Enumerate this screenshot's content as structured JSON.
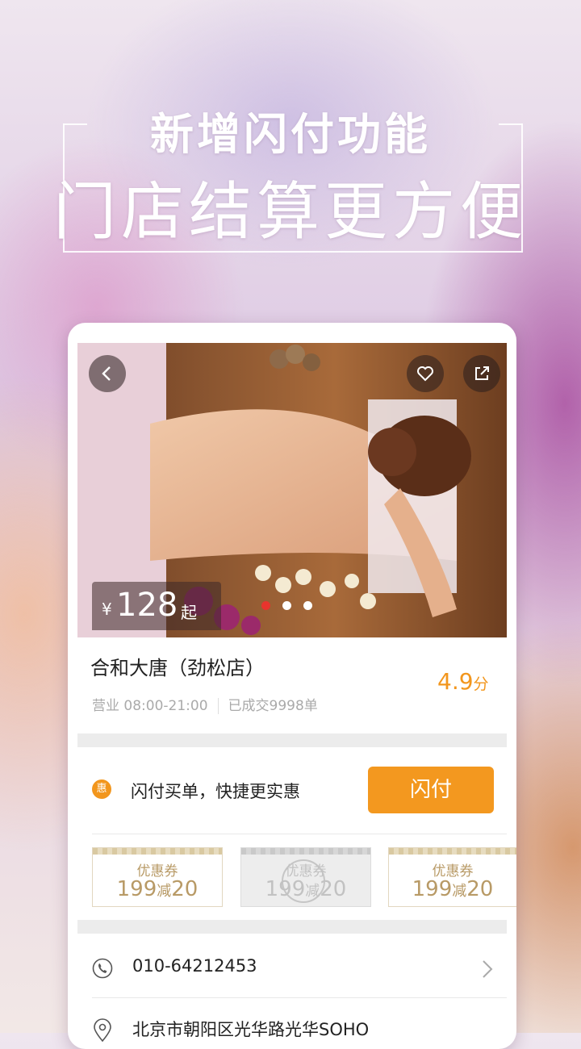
{
  "headline": {
    "line1": "新增闪付功能",
    "line2": "门店结算更方便"
  },
  "shop": {
    "price_currency": "¥",
    "price_value": "128",
    "price_suffix": "起",
    "name": "合和大唐（劲松店）",
    "rating_value": "4.9",
    "rating_unit": "分",
    "hours": "营业 08:00-21:00",
    "sold": "已成交9998单",
    "carousel": {
      "count": 3,
      "active": 0
    }
  },
  "promo": {
    "badge": "惠",
    "text": "闪付买单，快捷更实惠",
    "button": "闪付"
  },
  "coupons": [
    {
      "title": "优惠券",
      "amount_a": "199",
      "amount_mid": "减",
      "amount_b": "20",
      "state": "available"
    },
    {
      "title": "优惠券",
      "amount_a": "199",
      "amount_mid": "减",
      "amount_b": "20",
      "state": "used"
    },
    {
      "title": "优惠券",
      "amount_a": "199",
      "amount_mid": "减",
      "amount_b": "20",
      "state": "available"
    }
  ],
  "contact": {
    "phone": "010-64212453",
    "address": "北京市朝阳区光华路光华SOHO"
  },
  "icons": {
    "back": "back-icon",
    "favorite": "heart-icon",
    "share": "share-icon",
    "phone": "phone-icon",
    "location": "location-icon",
    "chevron": "chevron-right-icon"
  },
  "colors": {
    "accent": "#f3981f",
    "coupon": "#b89a66"
  }
}
